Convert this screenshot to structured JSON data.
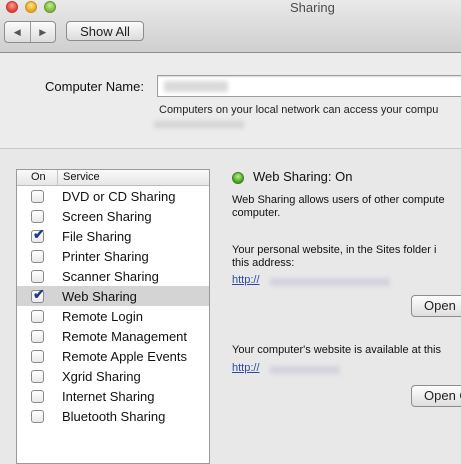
{
  "window": {
    "title": "Sharing",
    "traffic_lights": [
      "close",
      "minimize",
      "zoom"
    ]
  },
  "toolbar": {
    "back_icon": "◀",
    "forward_icon": "▶",
    "show_all_label": "Show All"
  },
  "computer_name": {
    "label": "Computer Name:",
    "value": "",
    "help_text": "Computers on your local network can access your compu"
  },
  "services": {
    "header_on": "On",
    "header_service": "Service",
    "items": [
      {
        "name": "DVD or CD Sharing",
        "checked": false,
        "selected": false
      },
      {
        "name": "Screen Sharing",
        "checked": false,
        "selected": false
      },
      {
        "name": "File Sharing",
        "checked": true,
        "selected": false
      },
      {
        "name": "Printer Sharing",
        "checked": false,
        "selected": false
      },
      {
        "name": "Scanner Sharing",
        "checked": false,
        "selected": false
      },
      {
        "name": "Web Sharing",
        "checked": true,
        "selected": true
      },
      {
        "name": "Remote Login",
        "checked": false,
        "selected": false
      },
      {
        "name": "Remote Management",
        "checked": false,
        "selected": false
      },
      {
        "name": "Remote Apple Events",
        "checked": false,
        "selected": false
      },
      {
        "name": "Xgrid Sharing",
        "checked": false,
        "selected": false
      },
      {
        "name": "Internet Sharing",
        "checked": false,
        "selected": false
      },
      {
        "name": "Bluetooth Sharing",
        "checked": false,
        "selected": false
      }
    ]
  },
  "detail": {
    "status": "Web Sharing: On",
    "status_color": "#3fa11d",
    "description_line1": "Web Sharing allows users of other compute",
    "description_line2": "computer.",
    "personal_line1": "Your personal website, in the Sites folder i",
    "personal_line2": "this address:",
    "personal_url": "http://",
    "personal_open_label": "Open",
    "computer_line": "Your computer's website is available at this",
    "computer_url": "http://",
    "computer_open_label": "Open C"
  }
}
